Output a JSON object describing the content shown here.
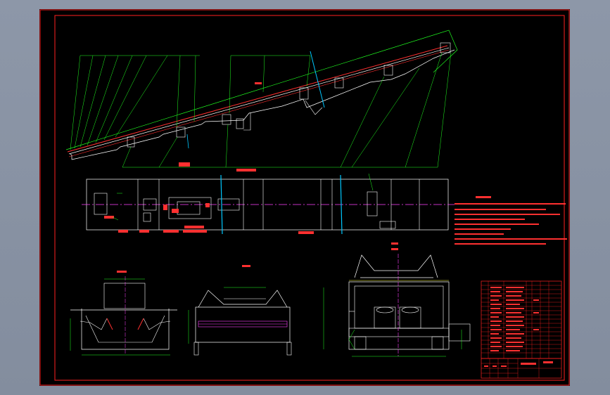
{
  "colors": {
    "background": "#8c96a6",
    "sheet": "#000000",
    "frame": "#ff2020",
    "geometry": "#ffffff",
    "leaders": "#20ff20",
    "centerline": "#ff40ff",
    "belt": "#ff3030",
    "accent": "#00c8ff",
    "text": "#ff3030"
  },
  "drawing": {
    "description_lines": 9,
    "bom_rows": 18,
    "views": [
      "elevation",
      "plan",
      "section-1",
      "section-2",
      "section-3"
    ]
  }
}
